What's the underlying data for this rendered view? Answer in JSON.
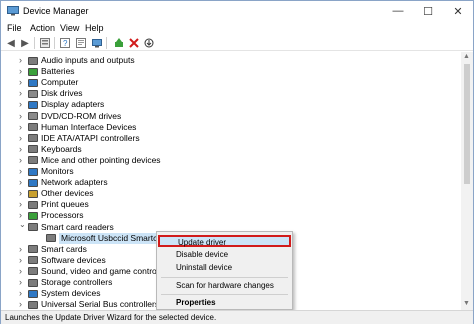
{
  "window": {
    "title": "Device Manager",
    "controls": {
      "minimize": "—",
      "maximize": "☐",
      "close": "✕"
    }
  },
  "menu": [
    "File",
    "Action",
    "View",
    "Help"
  ],
  "toolbar": {
    "buttons": [
      "back-icon",
      "forward-icon",
      "show-hidden-icon",
      "help-icon",
      "properties-icon",
      "scan-icon",
      "remove-device-icon",
      "disable-device-icon"
    ]
  },
  "tree": {
    "rows": [
      {
        "label": "Audio inputs and outputs",
        "expanded": false,
        "indent": 0,
        "icon_color": "#7c7c7c"
      },
      {
        "label": "Batteries",
        "expanded": false,
        "indent": 0,
        "icon_color": "#3aa03a"
      },
      {
        "label": "Computer",
        "expanded": false,
        "indent": 0,
        "icon_color": "#2f78c4"
      },
      {
        "label": "Disk drives",
        "expanded": false,
        "indent": 0,
        "icon_color": "#8a8a8a"
      },
      {
        "label": "Display adapters",
        "expanded": false,
        "indent": 0,
        "icon_color": "#2f78c4"
      },
      {
        "label": "DVD/CD-ROM drives",
        "expanded": false,
        "indent": 0,
        "icon_color": "#8a8a8a"
      },
      {
        "label": "Human Interface Devices",
        "expanded": false,
        "indent": 0,
        "icon_color": "#7c7c7c"
      },
      {
        "label": "IDE ATA/ATAPI controllers",
        "expanded": false,
        "indent": 0,
        "icon_color": "#7c7c7c"
      },
      {
        "label": "Keyboards",
        "expanded": false,
        "indent": 0,
        "icon_color": "#7c7c7c"
      },
      {
        "label": "Mice and other pointing devices",
        "expanded": false,
        "indent": 0,
        "icon_color": "#7c7c7c"
      },
      {
        "label": "Monitors",
        "expanded": false,
        "indent": 0,
        "icon_color": "#2f78c4"
      },
      {
        "label": "Network adapters",
        "expanded": false,
        "indent": 0,
        "icon_color": "#2f78c4"
      },
      {
        "label": "Other devices",
        "expanded": false,
        "indent": 0,
        "icon_color": "#c8a030"
      },
      {
        "label": "Print queues",
        "expanded": false,
        "indent": 0,
        "icon_color": "#7c7c7c"
      },
      {
        "label": "Processors",
        "expanded": false,
        "indent": 0,
        "icon_color": "#3aa03a"
      },
      {
        "label": "Smart card readers",
        "expanded": true,
        "indent": 0,
        "icon_color": "#7c7c7c"
      },
      {
        "label": "Microsoft Usbccid Smartcard Reader (WUDF)",
        "expanded": null,
        "indent": 1,
        "icon_color": "#7c7c7c",
        "selected": true
      },
      {
        "label": "Smart cards",
        "expanded": false,
        "indent": 0,
        "icon_color": "#7c7c7c"
      },
      {
        "label": "Software devices",
        "expanded": false,
        "indent": 0,
        "icon_color": "#7c7c7c"
      },
      {
        "label": "Sound, video and game controllers",
        "expanded": false,
        "indent": 0,
        "icon_color": "#7c7c7c"
      },
      {
        "label": "Storage controllers",
        "expanded": false,
        "indent": 0,
        "icon_color": "#7c7c7c"
      },
      {
        "label": "System devices",
        "expanded": false,
        "indent": 0,
        "icon_color": "#2f78c4"
      },
      {
        "label": "Universal Serial Bus controllers",
        "expanded": false,
        "indent": 0,
        "icon_color": "#7c7c7c"
      }
    ]
  },
  "context_menu": {
    "items": [
      {
        "label": "Update driver",
        "highlighted": true
      },
      {
        "label": "Disable device"
      },
      {
        "label": "Uninstall device"
      },
      {
        "label": "Scan for hardware changes"
      },
      {
        "label": "Properties",
        "bold": true
      }
    ]
  },
  "status_bar": {
    "text": "Launches the Update Driver Wizard for the selected device."
  },
  "colors": {
    "highlight": "#cce4f7",
    "red_outline": "#d11b1b",
    "window_border": "#8aa4c7"
  }
}
